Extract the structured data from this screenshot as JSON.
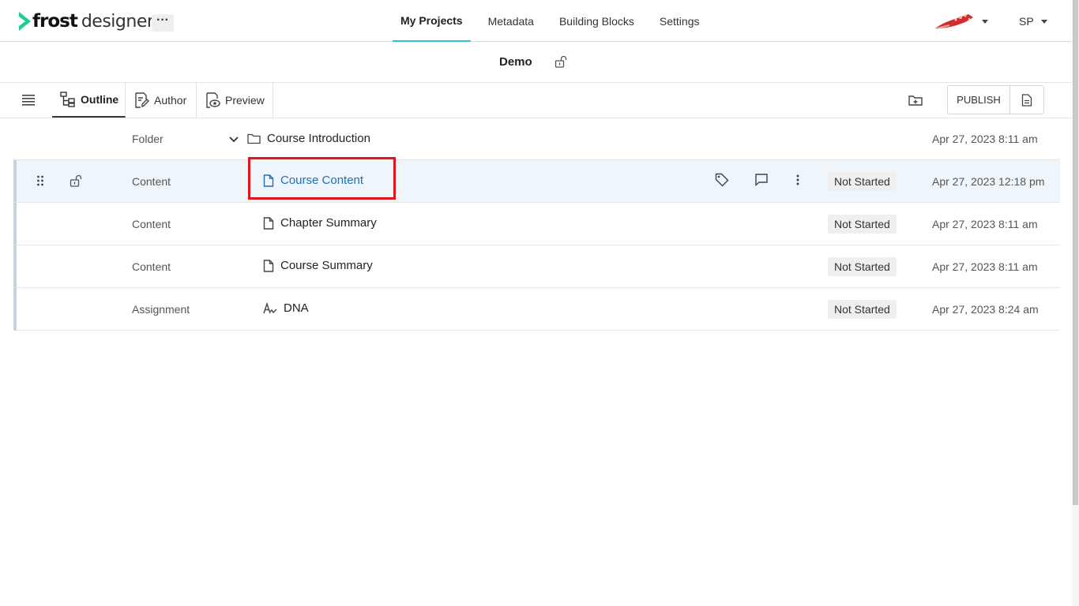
{
  "app": {
    "logo_frost": "frost",
    "logo_designer": "designer",
    "more_label": "···"
  },
  "nav": {
    "items": [
      {
        "label": "My Projects",
        "active": true
      },
      {
        "label": "Metadata",
        "active": false
      },
      {
        "label": "Building Blocks",
        "active": false
      },
      {
        "label": "Settings",
        "active": false
      }
    ]
  },
  "user": {
    "initials": "SP"
  },
  "project": {
    "title": "Demo"
  },
  "toolbar": {
    "tabs": [
      {
        "label": "Outline",
        "active": true,
        "icon": "outline-icon"
      },
      {
        "label": "Author",
        "active": false,
        "icon": "author-icon"
      },
      {
        "label": "Preview",
        "active": false,
        "icon": "preview-icon"
      }
    ],
    "publish_label": "PUBLISH"
  },
  "outline": {
    "rows": [
      {
        "type": "Folder",
        "name": "Course Introduction",
        "icon": "folder-icon",
        "status": "",
        "date": "Apr 27, 2023 8:11 am"
      },
      {
        "type": "Content",
        "name": "Course Content",
        "icon": "document-icon",
        "status": "Not Started",
        "date": "Apr 27, 2023 12:18 pm",
        "selected": true
      },
      {
        "type": "Content",
        "name": "Chapter Summary",
        "icon": "document-icon",
        "status": "Not Started",
        "date": "Apr 27, 2023 8:11 am"
      },
      {
        "type": "Content",
        "name": "Course Summary",
        "icon": "document-icon",
        "status": "Not Started",
        "date": "Apr 27, 2023 8:11 am"
      },
      {
        "type": "Assignment",
        "name": "DNA",
        "icon": "assignment-icon",
        "status": "Not Started",
        "date": "Apr 27, 2023 8:24 am"
      }
    ]
  },
  "colors": {
    "accent": "#2ec4dd",
    "link": "#1e6fb5",
    "highlight": "#e0141c",
    "selected_row": "#eef6fc"
  }
}
